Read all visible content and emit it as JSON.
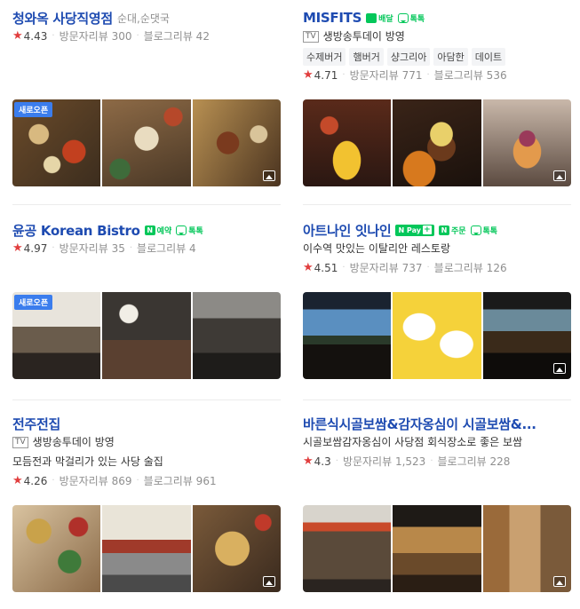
{
  "places": [
    {
      "name": "청와옥 사당직영점",
      "category": "순대,순댓국",
      "rating": "4.43",
      "visitor_reviews": "방문자리뷰 300",
      "blog_reviews": "블로그리뷰 42",
      "new_open": "새로오픈"
    },
    {
      "name": "MISFITS",
      "badge_delivery": "배달",
      "badge_talk": "톡톡",
      "tv_label": "TV",
      "tv_text": "생방송투데이 방영",
      "tags": [
        "수제버거",
        "햄버거",
        "샹그리아",
        "아담한",
        "데이트"
      ],
      "rating": "4.71",
      "visitor_reviews": "방문자리뷰 771",
      "blog_reviews": "블로그리뷰 536"
    },
    {
      "name": "윤공 Korean Bistro",
      "badge_n": "N",
      "badge_reserve": "예약",
      "badge_talk": "톡톡",
      "rating": "4.97",
      "visitor_reviews": "방문자리뷰 35",
      "blog_reviews": "블로그리뷰 4",
      "new_open": "새로오픈"
    },
    {
      "name": "아트나인 잇나인",
      "badge_npay": "N Pay",
      "badge_plus": "+",
      "badge_n": "N",
      "badge_order": "주문",
      "badge_talk": "톡톡",
      "description": "이수역 맛있는 이탈리안 레스토랑",
      "rating": "4.51",
      "visitor_reviews": "방문자리뷰 737",
      "blog_reviews": "블로그리뷰 126"
    },
    {
      "name": "전주전집",
      "tv_label": "TV",
      "tv_text": "생방송투데이 방영",
      "description": "모듬전과 막걸리가 있는 사당 술집",
      "rating": "4.26",
      "visitor_reviews": "방문자리뷰 869",
      "blog_reviews": "블로그리뷰 961"
    },
    {
      "name": "바른식시골보쌈&감자옹심이 시골보쌈&...",
      "description": "시골보쌈감자옹심이 사당점 회식장소로 좋은 보쌈",
      "rating": "4.3",
      "visitor_reviews": "방문자리뷰 1,523",
      "blog_reviews": "블로그리뷰 228"
    }
  ],
  "icons": {
    "star": "star-icon",
    "photo": "photo-icon",
    "talk": "talk-icon",
    "delivery": "delivery-icon"
  },
  "colors": {
    "title": "#1e4bb1",
    "star": "#e13e3e",
    "naver_green": "#03c75a",
    "new_open_badge": "#3b7ded"
  }
}
